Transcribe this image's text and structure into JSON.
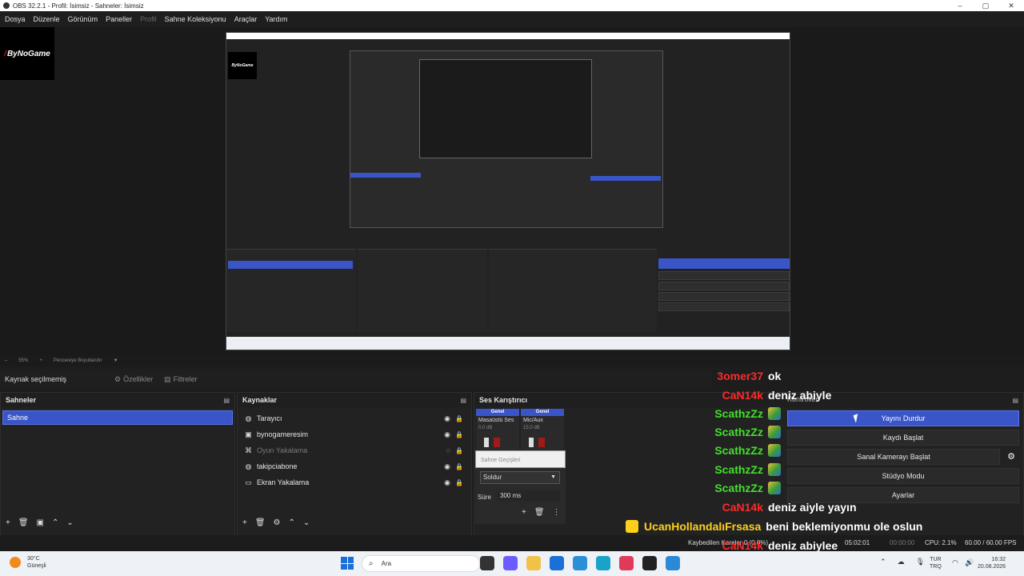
{
  "window": {
    "title": "OBS 32.2.1 - Profil: İsimsiz - Sahneler: İsimsiz",
    "controls": [
      "–",
      "▢",
      "✕"
    ]
  },
  "menu": [
    "Dosya",
    "Düzenle",
    "Görünüm",
    "Paneller",
    "Profil",
    "Sahne Koleksiyonu",
    "Araçlar",
    "Yardım"
  ],
  "preview": {
    "logo_text": "ByNoGame",
    "nested_logo_text": "ByNoGame",
    "zoom": "55%",
    "zoom_minus": "–",
    "zoom_plus": "+",
    "fit_label": "Pencereye Boyutlandır"
  },
  "source_toolbar": {
    "no_source": "Kaynak seçilmemiş",
    "properties": "Özellikler",
    "filters": "Filtreler"
  },
  "scenes": {
    "title": "Sahneler",
    "items": [
      "Sahne"
    ]
  },
  "sources": {
    "title": "Kaynaklar",
    "items": [
      {
        "label": "Tarayıcı",
        "icon": "globe-icon"
      },
      {
        "label": "bynogameresim",
        "icon": "image-icon"
      },
      {
        "label": "Oyun Yakalama",
        "icon": "gamepad-icon"
      },
      {
        "label": "takipciabone",
        "icon": "globe-icon"
      },
      {
        "label": "Ekran Yakalama",
        "icon": "monitor-icon"
      }
    ]
  },
  "mixer": {
    "title": "Ses Karıştırıcı",
    "channels": [
      {
        "header": "Genel",
        "name": "Masaüstü Ses",
        "db": "0.0 dB"
      },
      {
        "header": "Genel",
        "name": "Mic/Aux",
        "db": "15.0 dB"
      }
    ]
  },
  "transitions": {
    "title": "Sahne Geçişleri",
    "selected": "Soldur",
    "duration_label": "Süre",
    "duration_value": "300 ms"
  },
  "controls": {
    "title": "Kontroller",
    "buttons": [
      "Yayını Durdur",
      "Kaydı Başlat",
      "Sanal Kamerayı Başlat",
      "Stüdyo Modu",
      "Ayarlar"
    ]
  },
  "chat": [
    {
      "user": "3omer37",
      "color": "red",
      "badge": false,
      "msg": "ok"
    },
    {
      "user": "CaN14k",
      "color": "red",
      "badge": false,
      "msg": "deniz abiyle"
    },
    {
      "user": "ScathzZz",
      "color": "green",
      "badge": true,
      "msg": ""
    },
    {
      "user": "ScathzZz",
      "color": "green",
      "badge": true,
      "msg": ""
    },
    {
      "user": "ScathzZz",
      "color": "green",
      "badge": true,
      "msg": ""
    },
    {
      "user": "ScathzZz",
      "color": "green",
      "badge": true,
      "msg": ""
    },
    {
      "user": "ScathzZz",
      "color": "green",
      "badge": true,
      "msg": ""
    },
    {
      "user": "CaN14k",
      "color": "red",
      "badge": false,
      "msg": "deniz aiyle yayın"
    },
    {
      "user": "UcanHollandalıFrsasa",
      "color": "gold",
      "badge": true,
      "msg": "beni beklemiyonmu ole oslun"
    },
    {
      "user": "CaN14k",
      "color": "red",
      "badge": false,
      "msg": "deniz abiylee"
    }
  ],
  "status": {
    "dropped": "Kaybedilen Kareler 0 (0.0%)",
    "live_time": "05:02:01",
    "rec_time": "00:00:00",
    "cpu": "CPU: 2.1%",
    "fps": "60.00 / 60.00 FPS"
  },
  "taskbar": {
    "temp": "30°C",
    "weather": "Güneşli",
    "search": "Ara",
    "lang_top": "TUR",
    "lang_bottom": "TRQ",
    "time": "16:32",
    "date": "20.08.2026"
  },
  "colors": {
    "accent": "#3a55c8",
    "chat_red": "#ff2a2a",
    "chat_green": "#42e02a",
    "chat_gold": "#ffd11c"
  }
}
